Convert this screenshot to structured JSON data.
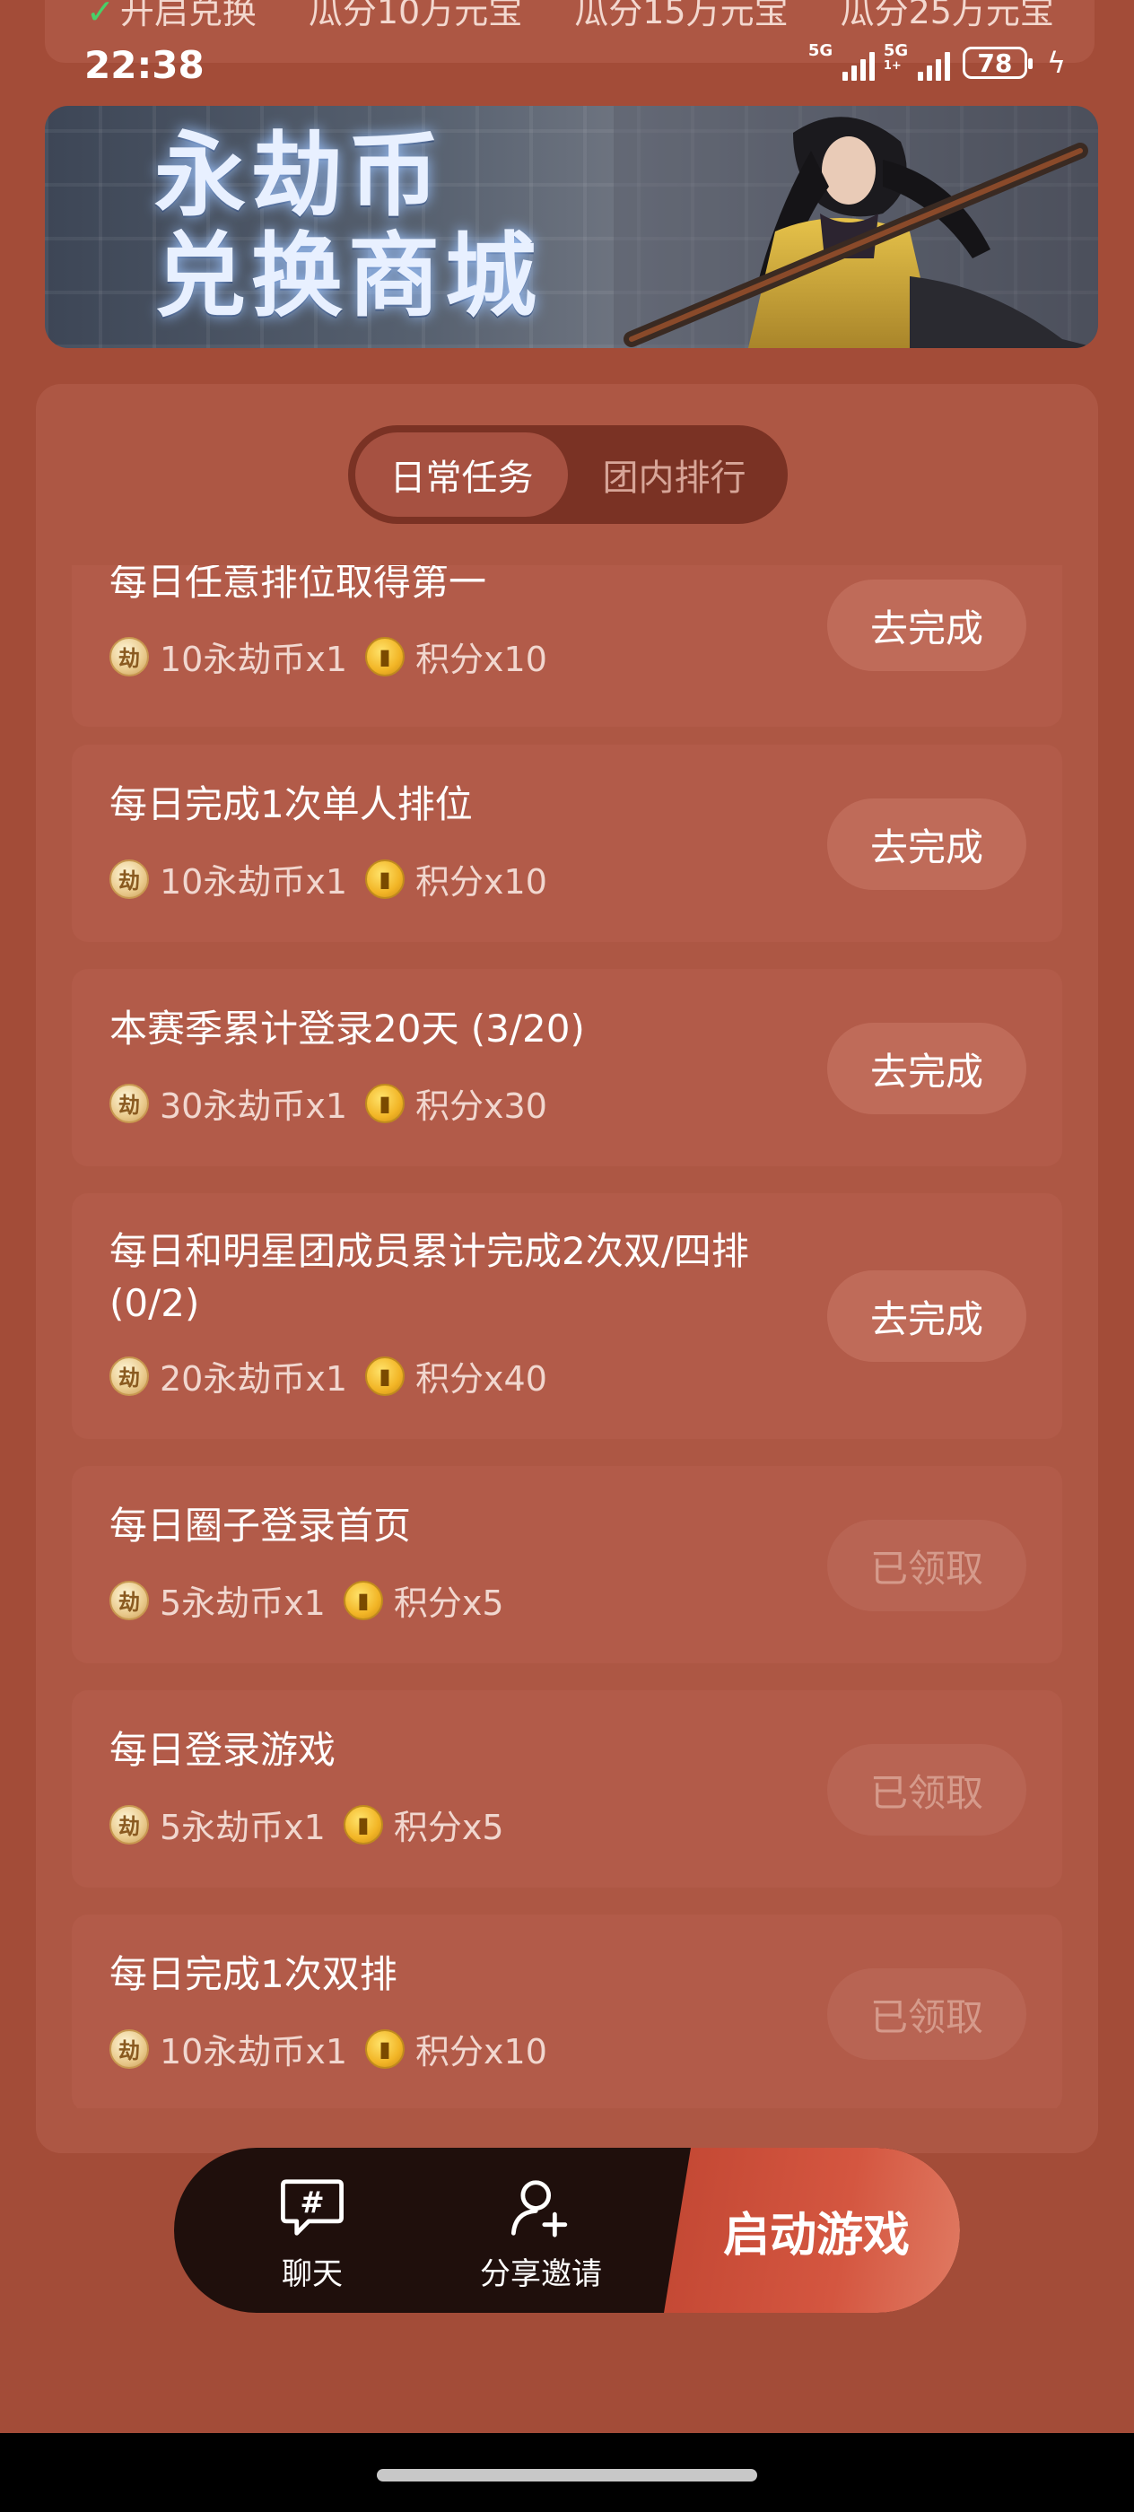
{
  "ribbon": {
    "items": [
      "开启兑换",
      "瓜分10万元宝",
      "瓜分15万元宝",
      "瓜分25万元宝"
    ]
  },
  "status_bar": {
    "time": "22:38",
    "network_1": "5G",
    "network_2": "5G",
    "network_2_sub": "1+",
    "battery": "78"
  },
  "banner": {
    "line1": "永劫币",
    "line2": "兑换商城"
  },
  "tabs": [
    {
      "label": "日常任务",
      "active": true
    },
    {
      "label": "团内排行",
      "active": false
    }
  ],
  "tasks": [
    {
      "title": "每日任意排位取得第一",
      "coins": "10永劫币x1",
      "points": "积分x10",
      "action": "去完成",
      "claimed": false
    },
    {
      "title": "每日完成1次单人排位",
      "coins": "10永劫币x1",
      "points": "积分x10",
      "action": "去完成",
      "claimed": false
    },
    {
      "title": "本赛季累计登录20天 (3/20)",
      "coins": "30永劫币x1",
      "points": "积分x30",
      "action": "去完成",
      "claimed": false
    },
    {
      "title": "每日和明星团成员累计完成2次双/四排 (0/2)",
      "coins": "20永劫币x1",
      "points": "积分x40",
      "action": "去完成",
      "claimed": false
    },
    {
      "title": "每日圈子登录首页",
      "coins": "5永劫币x1",
      "points": "积分x5",
      "action": "已领取",
      "claimed": true
    },
    {
      "title": "每日登录游戏",
      "coins": "5永劫币x1",
      "points": "积分x5",
      "action": "已领取",
      "claimed": true
    },
    {
      "title": "每日完成1次双排",
      "coins": "10永劫币x1",
      "points": "积分x10",
      "action": "已领取",
      "claimed": true
    }
  ],
  "dock": {
    "chat_label": "聊天",
    "share_label": "分享邀请",
    "launch_label": "启动游戏"
  }
}
